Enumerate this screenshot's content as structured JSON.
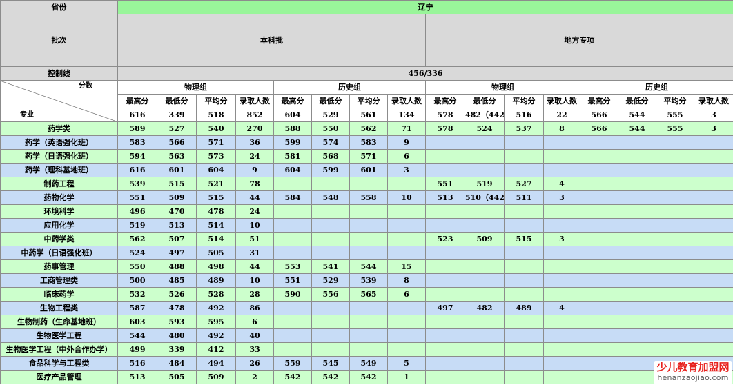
{
  "header": {
    "province_label": "省份",
    "province_value": "辽宁",
    "batch_label": "批次",
    "batch_main": "本科批",
    "batch_local": "地方专项",
    "control_label": "控制线",
    "control_value": "456/336",
    "group_physics": "物理组",
    "group_history": "历史组",
    "corner_top": "分数",
    "corner_bottom": "专业",
    "col_max": "最高分",
    "col_min": "最低分",
    "col_avg": "平均分",
    "col_count": "录取人数"
  },
  "summary": [
    "616",
    "339",
    "518",
    "852",
    "604",
    "529",
    "561",
    "134",
    "578",
    "482（442）",
    "516",
    "22",
    "566",
    "544",
    "555",
    "3"
  ],
  "rows": [
    {
      "name": "药学类",
      "cells": [
        "589",
        "527",
        "540",
        "270",
        "588",
        "550",
        "562",
        "71",
        "578",
        "524",
        "537",
        "8",
        "566",
        "544",
        "555",
        "3"
      ]
    },
    {
      "name": "药学（英语强化班）",
      "cells": [
        "583",
        "566",
        "571",
        "36",
        "599",
        "574",
        "583",
        "9",
        "",
        "",
        "",
        "",
        "",
        "",
        "",
        ""
      ]
    },
    {
      "name": "药学（日语强化班）",
      "cells": [
        "594",
        "563",
        "573",
        "24",
        "581",
        "568",
        "571",
        "6",
        "",
        "",
        "",
        "",
        "",
        "",
        "",
        ""
      ]
    },
    {
      "name": "药学（理科基地班）",
      "cells": [
        "616",
        "601",
        "604",
        "9",
        "604",
        "599",
        "601",
        "3",
        "",
        "",
        "",
        "",
        "",
        "",
        "",
        ""
      ]
    },
    {
      "name": "制药工程",
      "cells": [
        "539",
        "515",
        "521",
        "78",
        "",
        "",
        "",
        "",
        "551",
        "519",
        "527",
        "4",
        "",
        "",
        "",
        ""
      ]
    },
    {
      "name": "药物化学",
      "cells": [
        "551",
        "509",
        "515",
        "44",
        "584",
        "548",
        "558",
        "10",
        "513",
        "510（442）",
        "511",
        "3",
        "",
        "",
        "",
        ""
      ]
    },
    {
      "name": "环境科学",
      "cells": [
        "496",
        "470",
        "478",
        "24",
        "",
        "",
        "",
        "",
        "",
        "",
        "",
        "",
        "",
        "",
        "",
        ""
      ]
    },
    {
      "name": "应用化学",
      "cells": [
        "519",
        "513",
        "514",
        "10",
        "",
        "",
        "",
        "",
        "",
        "",
        "",
        "",
        "",
        "",
        "",
        ""
      ]
    },
    {
      "name": "中药学类",
      "cells": [
        "562",
        "507",
        "514",
        "51",
        "",
        "",
        "",
        "",
        "523",
        "509",
        "515",
        "3",
        "",
        "",
        "",
        ""
      ]
    },
    {
      "name": "中药学（日语强化班）",
      "cells": [
        "524",
        "497",
        "505",
        "31",
        "",
        "",
        "",
        "",
        "",
        "",
        "",
        "",
        "",
        "",
        "",
        ""
      ]
    },
    {
      "name": "药事管理",
      "cells": [
        "550",
        "488",
        "498",
        "44",
        "553",
        "541",
        "544",
        "15",
        "",
        "",
        "",
        "",
        "",
        "",
        "",
        ""
      ]
    },
    {
      "name": "工商管理类",
      "cells": [
        "500",
        "485",
        "489",
        "10",
        "551",
        "529",
        "539",
        "8",
        "",
        "",
        "",
        "",
        "",
        "",
        "",
        ""
      ]
    },
    {
      "name": "临床药学",
      "cells": [
        "532",
        "526",
        "528",
        "28",
        "590",
        "556",
        "565",
        "6",
        "",
        "",
        "",
        "",
        "",
        "",
        "",
        ""
      ]
    },
    {
      "name": "生物工程类",
      "cells": [
        "587",
        "478",
        "492",
        "86",
        "",
        "",
        "",
        "",
        "497",
        "482",
        "489",
        "4",
        "",
        "",
        "",
        ""
      ]
    },
    {
      "name": "生物制药（生命基地班）",
      "cells": [
        "603",
        "593",
        "595",
        "6",
        "",
        "",
        "",
        "",
        "",
        "",
        "",
        "",
        "",
        "",
        "",
        ""
      ]
    },
    {
      "name": "生物医学工程",
      "cells": [
        "544",
        "480",
        "492",
        "40",
        "",
        "",
        "",
        "",
        "",
        "",
        "",
        "",
        "",
        "",
        "",
        ""
      ]
    },
    {
      "name": "生物医学工程（中外合作办学）",
      "cells": [
        "499",
        "339",
        "412",
        "33",
        "",
        "",
        "",
        "",
        "",
        "",
        "",
        "",
        "",
        "",
        "",
        ""
      ]
    },
    {
      "name": "食品科学与工程类",
      "cells": [
        "516",
        "484",
        "494",
        "26",
        "559",
        "545",
        "549",
        "5",
        "",
        "",
        "",
        "",
        "",
        "",
        "",
        ""
      ]
    },
    {
      "name": "医疗产品管理",
      "cells": [
        "513",
        "505",
        "509",
        "2",
        "542",
        "542",
        "542",
        "1",
        "",
        "",
        "",
        "",
        "",
        "",
        "",
        ""
      ]
    }
  ],
  "watermark": {
    "line1": "少儿教育加盟网",
    "line2": "henanzaojiao.com"
  },
  "colors": {
    "header_gray": "#d9d9d9",
    "province_green": "#99f59a",
    "row_light_green": "#ccffcc",
    "row_light_blue": "#c7dcf6",
    "watermark_red": "#e8231f"
  }
}
